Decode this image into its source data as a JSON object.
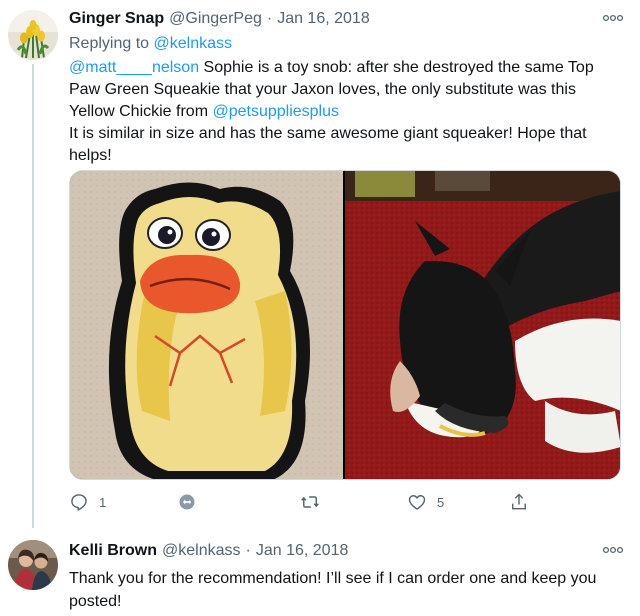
{
  "tweets": [
    {
      "author_name": "Ginger Snap",
      "author_handle": "@GingerPeg",
      "separator": "·",
      "date": "Jan 16, 2018",
      "replying_prefix": "Replying to",
      "replying_to": "@kelnkass",
      "mention1": "@matt____nelson",
      "text_part1": " Sophie is a toy snob: after she destroyed the same Top Paw Green Squeakie that your Jaxon loves, the only substitute was this Yellow Chickie from ",
      "mention2": "@petsuppliesplus",
      "text_part2": "It is similar in size and has the same awesome giant squeaker! Hope that helps!",
      "reply_count": "1",
      "like_count": "5",
      "icons": [
        "more-icon",
        "reply-icon",
        "retweet-icon",
        "retweet-icon",
        "like-icon",
        "share-icon"
      ]
    },
    {
      "author_name": "Kelli Brown",
      "author_handle": "@kelnkass",
      "separator": "·",
      "date": "Jan 16, 2018",
      "text": "Thank you for the recommendation! I’ll see if I can order one and keep you posted!",
      "icons": [
        "more-icon"
      ]
    }
  ],
  "colors": {
    "link": "#1d9bf0",
    "secondary_text": "#536471",
    "primary_text": "#0f1419",
    "border": "#cfd9de"
  }
}
